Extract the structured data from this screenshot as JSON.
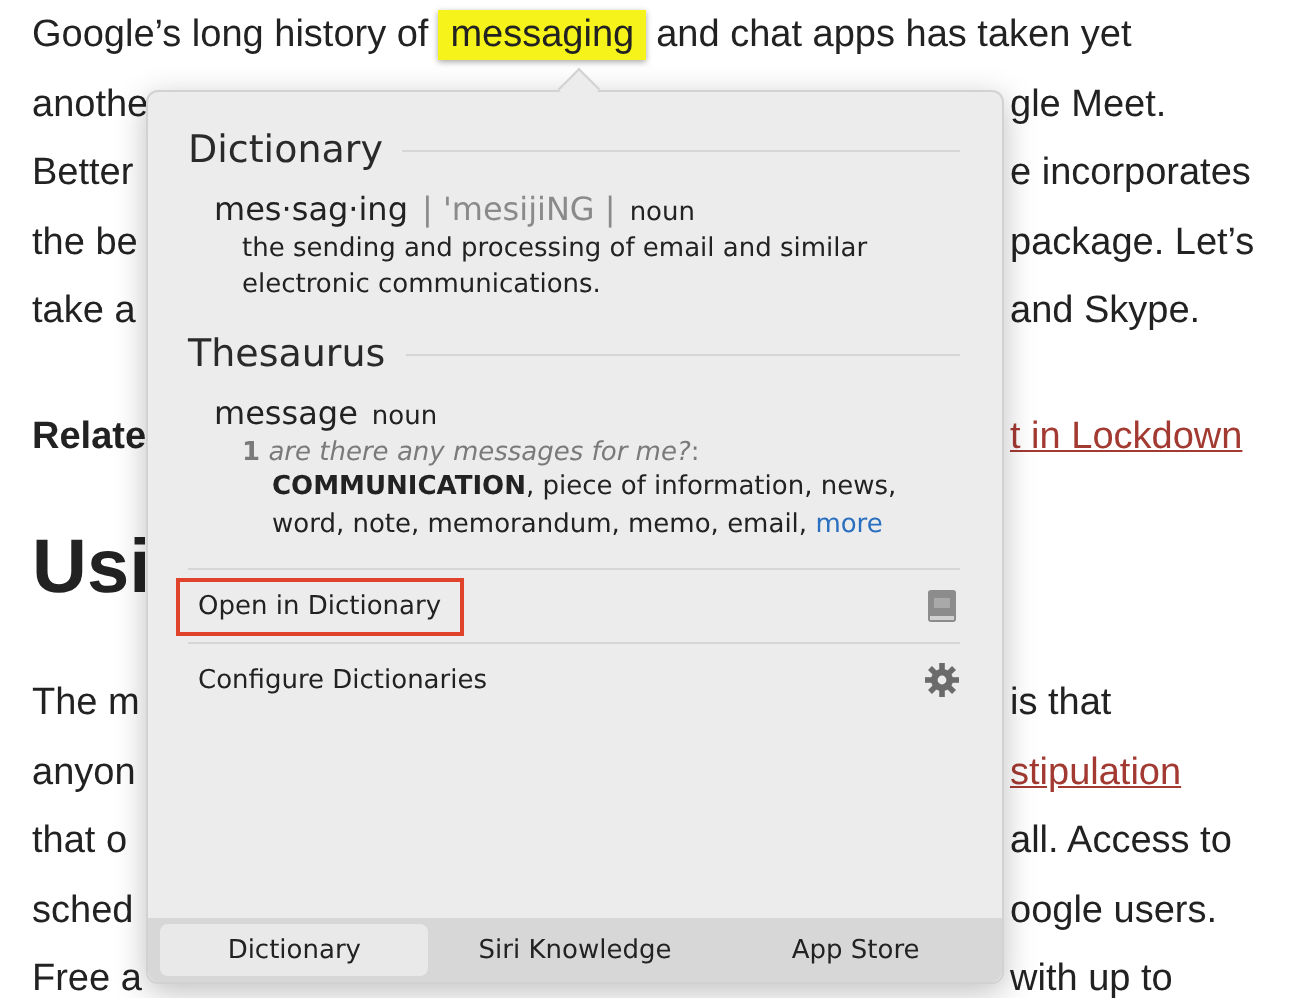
{
  "article": {
    "lines": [
      {
        "kind": "full",
        "left": [
          {
            "kind": "plain",
            "text": "Google’s long history of"
          },
          {
            "kind": "highlight",
            "text": "messaging"
          },
          {
            "kind": "plain",
            "text": "and chat apps has taken yet"
          }
        ]
      },
      {
        "kind": "body",
        "left": [
          {
            "kind": "plain",
            "text": "anothe"
          }
        ],
        "right": [
          {
            "kind": "plain",
            "text": "gle Meet."
          }
        ]
      },
      {
        "kind": "body",
        "left": [
          {
            "kind": "plain",
            "text": "Better"
          }
        ],
        "right": [
          {
            "kind": "plain",
            "text": "e incorporates"
          }
        ]
      },
      {
        "kind": "body",
        "left": [
          {
            "kind": "plain",
            "text": "the be"
          }
        ],
        "right": [
          {
            "kind": "plain",
            "text": "package. Let’s"
          }
        ]
      },
      {
        "kind": "body",
        "left": [
          {
            "kind": "plain",
            "text": "take a"
          }
        ],
        "right": [
          {
            "kind": "plain",
            "text": "and Skype."
          }
        ]
      },
      {
        "kind": "related",
        "left": [
          {
            "kind": "plain",
            "text": "Relate"
          }
        ],
        "right": [
          {
            "kind": "link",
            "text": "t in Lockdown"
          }
        ]
      },
      {
        "kind": "heading",
        "left": [
          {
            "kind": "plain",
            "text": "Usi"
          }
        ]
      },
      {
        "kind": "body",
        "left": [
          {
            "kind": "plain",
            "text": "The m"
          }
        ],
        "right": [
          {
            "kind": "plain",
            "text": "is that"
          }
        ]
      },
      {
        "kind": "body",
        "left": [
          {
            "kind": "plain",
            "text": "anyon"
          }
        ],
        "right": [
          {
            "kind": "link",
            "text": "stipulation"
          }
        ]
      },
      {
        "kind": "body",
        "left": [
          {
            "kind": "plain",
            "text": "that o"
          }
        ],
        "right": [
          {
            "kind": "plain",
            "text": "all. Access to"
          }
        ]
      },
      {
        "kind": "body",
        "left": [
          {
            "kind": "plain",
            "text": "sched"
          }
        ],
        "right": [
          {
            "kind": "plain",
            "text": "oogle users."
          }
        ]
      },
      {
        "kind": "body",
        "left": [
          {
            "kind": "plain",
            "text": "Free a"
          }
        ],
        "right": [
          {
            "kind": "plain",
            "text": "with up to"
          }
        ]
      }
    ]
  },
  "popover": {
    "dictionary": {
      "title": "Dictionary",
      "headword": "mes·sag·ing",
      "pronunciation": "| 'mesijiNG |",
      "part_of_speech": "noun",
      "definition": "the sending and processing of email and similar electronic communications."
    },
    "thesaurus": {
      "title": "Thesaurus",
      "headword": "message",
      "part_of_speech": "noun",
      "example": "**1** *are there any messages for me?*:",
      "synonyms": "**COMMUNICATION**, piece of information, news, word, note, memorandum, memo, email,",
      "more_link": "more"
    },
    "actions": [
      {
        "label": "Open in Dictionary",
        "kind": "book",
        "highlighted": true
      },
      {
        "label": "Configure Dictionaries",
        "kind": "gear",
        "highlighted": false
      }
    ],
    "tabs": [
      {
        "label": "Dictionary",
        "selected": true
      },
      {
        "label": "Siri Knowledge",
        "selected": false
      },
      {
        "label": "App Store",
        "selected": false
      }
    ]
  }
}
